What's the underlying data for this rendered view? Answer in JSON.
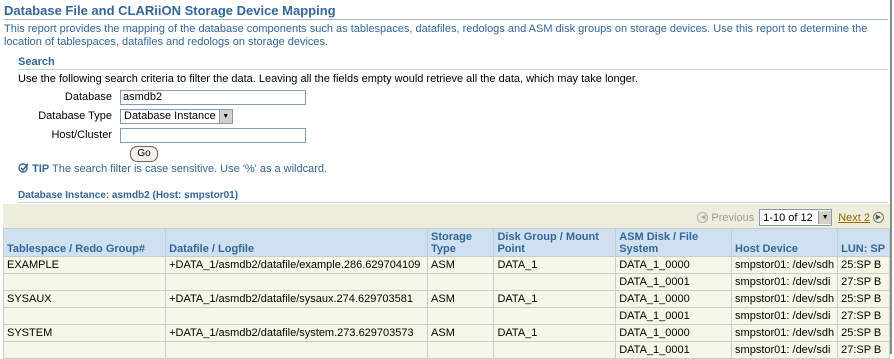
{
  "page": {
    "title": "Database File and CLARiiON Storage Device Mapping",
    "description": "This report provides the mapping of the database components such as tablespaces, datafiles, redologs and ASM disk groups on storage devices. Use this report to determine the location of tablespaces, datafiles and redologs on storage devices."
  },
  "search": {
    "heading": "Search",
    "instructions": "Use the following search criteria to filter the data. Leaving all the fields empty would retrieve all the data, which may take longer.",
    "database_label": "Database",
    "database_value": "asmdb2",
    "type_label": "Database Type",
    "type_value": "Database Instance",
    "host_label": "Host/Cluster",
    "host_value": "",
    "go_label": "Go",
    "tip_label": "TIP",
    "tip_text": "The search filter is case sensitive. Use '%' as a wildcard."
  },
  "results": {
    "instance_title": "Database Instance: asmdb2 (Host: smpstor01)",
    "pager": {
      "previous_label": "Previous",
      "range": "1-10 of 12",
      "next_label": "Next 2"
    },
    "columns": [
      "Tablespace / Redo Group#",
      "Datafile / Logfile",
      "Storage Type",
      "Disk Group / Mount Point",
      "ASM Disk / File System",
      "Host Device",
      "LUN: SP"
    ],
    "rows": [
      [
        "EXAMPLE",
        "+DATA_1/asmdb2/datafile/example.286.629704109",
        "ASM",
        "DATA_1",
        "DATA_1_0000",
        "smpstor01: /dev/sdh",
        "25:SP B"
      ],
      [
        "",
        "",
        "",
        "",
        "DATA_1_0001",
        "smpstor01: /dev/sdi",
        "27:SP B"
      ],
      [
        "SYSAUX",
        "+DATA_1/asmdb2/datafile/sysaux.274.629703581",
        "ASM",
        "DATA_1",
        "DATA_1_0000",
        "smpstor01: /dev/sdh",
        "25:SP B"
      ],
      [
        "",
        "",
        "",
        "",
        "DATA_1_0001",
        "smpstor01: /dev/sdi",
        "27:SP B"
      ],
      [
        "SYSTEM",
        "+DATA_1/asmdb2/datafile/system.273.629703573",
        "ASM",
        "DATA_1",
        "DATA_1_0000",
        "smpstor01: /dev/sdh",
        "25:SP B"
      ],
      [
        "",
        "",
        "",
        "",
        "DATA_1_0001",
        "smpstor01: /dev/sdi",
        "27:SP B"
      ]
    ]
  }
}
